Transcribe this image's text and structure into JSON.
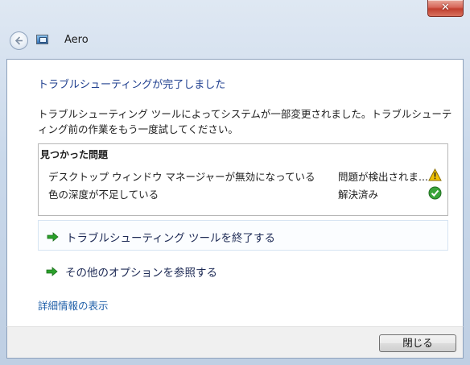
{
  "window": {
    "title": "Aero",
    "close_glyph": "✕"
  },
  "main": {
    "heading": "トラブルシューティングが完了しました",
    "description": "トラブルシューティング ツールによってシステムが一部変更されました。トラブルシューティング前の作業をもう一度試してください。",
    "problems": {
      "title": "見つかった問題",
      "rows": [
        {
          "name": "デスクトップ ウィンドウ マネージャーが無効になっている",
          "status": "問題が検出されま...",
          "icon": "warning-icon"
        },
        {
          "name": "色の深度が不足している",
          "status": "解決済み",
          "icon": "checkmark-icon"
        }
      ]
    },
    "options": [
      {
        "label": "トラブルシューティング ツールを終了する",
        "icon": "green-arrow-icon"
      },
      {
        "label": "その他のオプションを参照する",
        "icon": "green-arrow-icon"
      }
    ],
    "details_link": "詳細情報の表示"
  },
  "footer": {
    "close_button": "閉じる"
  },
  "colors": {
    "heading": "#1f3f8f",
    "link": "#1f5fa8",
    "arrow": "#2aa12a",
    "warning": "#f2c200",
    "check": "#3aa53a"
  }
}
